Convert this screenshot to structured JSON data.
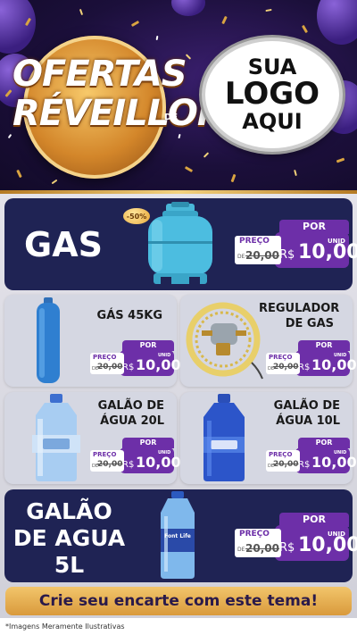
{
  "header": {
    "badge_line1": "OFERTAS",
    "badge_line2": "RÉVEILLON",
    "badge_de": "DE",
    "logo_line1": "SUA",
    "logo_line2": "LOGO",
    "logo_line3": "AQUI"
  },
  "products": [
    {
      "name": "GAS",
      "discount": "-50%",
      "por": "POR",
      "preco_label": "PREÇO",
      "de": "DE",
      "old_price": "20,00",
      "currency": "R$",
      "price": "10,00",
      "unit": "UNID"
    },
    {
      "name": "GÁS 45KG",
      "por": "POR",
      "preco_label": "PREÇO",
      "de": "DE",
      "old_price": "20,00",
      "currency": "R$",
      "price": "10,00",
      "unit": "UNID"
    },
    {
      "name_line1": "REGULADOR",
      "name_line2": "DE GAS",
      "por": "POR",
      "preco_label": "PREÇO",
      "de": "DE",
      "old_price": "20,00",
      "currency": "R$",
      "price": "10,00",
      "unit": "UNID"
    },
    {
      "name_line1": "GALÃO DE",
      "name_line2": "ÁGUA 20L",
      "por": "POR",
      "preco_label": "PREÇO",
      "de": "DE",
      "old_price": "20,00",
      "currency": "R$",
      "price": "10,00",
      "unit": "UNID"
    },
    {
      "name_line1": "GALÃO DE",
      "name_line2": "ÁGUA 10L",
      "por": "POR",
      "preco_label": "PREÇO",
      "de": "DE",
      "old_price": "20,00",
      "currency": "R$",
      "price": "10,00",
      "unit": "UNID"
    },
    {
      "name_line1": "GALÃO",
      "name_line2": "DE AGUA",
      "name_line3": "5L",
      "bottle_label": "Font Life",
      "por": "POR",
      "preco_label": "PREÇO",
      "de": "DE",
      "old_price": "20,00",
      "currency": "R$",
      "price": "10,00",
      "unit": "UNID"
    }
  ],
  "cta": "Crie seu encarte com este tema!",
  "footer": "*Imagens Meramente Ilustrativas",
  "colors": {
    "navy": "#1f2354",
    "purple": "#6d2fa8",
    "gold": "#e6b04f"
  }
}
